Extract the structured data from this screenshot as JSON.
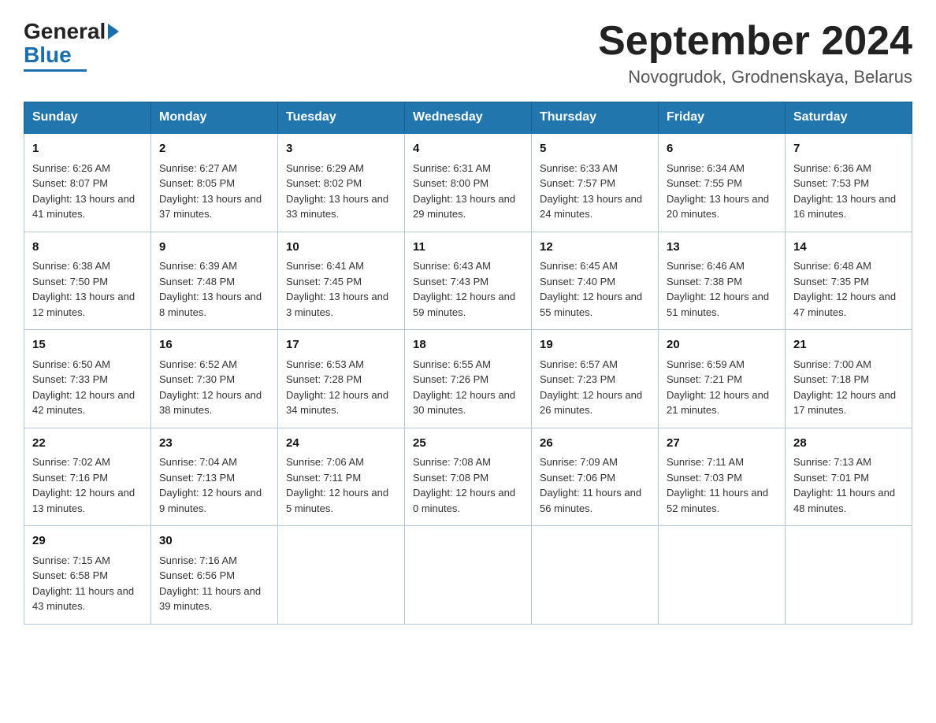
{
  "logo": {
    "general": "General",
    "blue": "Blue"
  },
  "title": "September 2024",
  "subtitle": "Novogrudok, Grodnenskaya, Belarus",
  "days_of_week": [
    "Sunday",
    "Monday",
    "Tuesday",
    "Wednesday",
    "Thursday",
    "Friday",
    "Saturday"
  ],
  "weeks": [
    [
      {
        "day": "1",
        "sunrise": "6:26 AM",
        "sunset": "8:07 PM",
        "daylight": "13 hours and 41 minutes."
      },
      {
        "day": "2",
        "sunrise": "6:27 AM",
        "sunset": "8:05 PM",
        "daylight": "13 hours and 37 minutes."
      },
      {
        "day": "3",
        "sunrise": "6:29 AM",
        "sunset": "8:02 PM",
        "daylight": "13 hours and 33 minutes."
      },
      {
        "day": "4",
        "sunrise": "6:31 AM",
        "sunset": "8:00 PM",
        "daylight": "13 hours and 29 minutes."
      },
      {
        "day": "5",
        "sunrise": "6:33 AM",
        "sunset": "7:57 PM",
        "daylight": "13 hours and 24 minutes."
      },
      {
        "day": "6",
        "sunrise": "6:34 AM",
        "sunset": "7:55 PM",
        "daylight": "13 hours and 20 minutes."
      },
      {
        "day": "7",
        "sunrise": "6:36 AM",
        "sunset": "7:53 PM",
        "daylight": "13 hours and 16 minutes."
      }
    ],
    [
      {
        "day": "8",
        "sunrise": "6:38 AM",
        "sunset": "7:50 PM",
        "daylight": "13 hours and 12 minutes."
      },
      {
        "day": "9",
        "sunrise": "6:39 AM",
        "sunset": "7:48 PM",
        "daylight": "13 hours and 8 minutes."
      },
      {
        "day": "10",
        "sunrise": "6:41 AM",
        "sunset": "7:45 PM",
        "daylight": "13 hours and 3 minutes."
      },
      {
        "day": "11",
        "sunrise": "6:43 AM",
        "sunset": "7:43 PM",
        "daylight": "12 hours and 59 minutes."
      },
      {
        "day": "12",
        "sunrise": "6:45 AM",
        "sunset": "7:40 PM",
        "daylight": "12 hours and 55 minutes."
      },
      {
        "day": "13",
        "sunrise": "6:46 AM",
        "sunset": "7:38 PM",
        "daylight": "12 hours and 51 minutes."
      },
      {
        "day": "14",
        "sunrise": "6:48 AM",
        "sunset": "7:35 PM",
        "daylight": "12 hours and 47 minutes."
      }
    ],
    [
      {
        "day": "15",
        "sunrise": "6:50 AM",
        "sunset": "7:33 PM",
        "daylight": "12 hours and 42 minutes."
      },
      {
        "day": "16",
        "sunrise": "6:52 AM",
        "sunset": "7:30 PM",
        "daylight": "12 hours and 38 minutes."
      },
      {
        "day": "17",
        "sunrise": "6:53 AM",
        "sunset": "7:28 PM",
        "daylight": "12 hours and 34 minutes."
      },
      {
        "day": "18",
        "sunrise": "6:55 AM",
        "sunset": "7:26 PM",
        "daylight": "12 hours and 30 minutes."
      },
      {
        "day": "19",
        "sunrise": "6:57 AM",
        "sunset": "7:23 PM",
        "daylight": "12 hours and 26 minutes."
      },
      {
        "day": "20",
        "sunrise": "6:59 AM",
        "sunset": "7:21 PM",
        "daylight": "12 hours and 21 minutes."
      },
      {
        "day": "21",
        "sunrise": "7:00 AM",
        "sunset": "7:18 PM",
        "daylight": "12 hours and 17 minutes."
      }
    ],
    [
      {
        "day": "22",
        "sunrise": "7:02 AM",
        "sunset": "7:16 PM",
        "daylight": "12 hours and 13 minutes."
      },
      {
        "day": "23",
        "sunrise": "7:04 AM",
        "sunset": "7:13 PM",
        "daylight": "12 hours and 9 minutes."
      },
      {
        "day": "24",
        "sunrise": "7:06 AM",
        "sunset": "7:11 PM",
        "daylight": "12 hours and 5 minutes."
      },
      {
        "day": "25",
        "sunrise": "7:08 AM",
        "sunset": "7:08 PM",
        "daylight": "12 hours and 0 minutes."
      },
      {
        "day": "26",
        "sunrise": "7:09 AM",
        "sunset": "7:06 PM",
        "daylight": "11 hours and 56 minutes."
      },
      {
        "day": "27",
        "sunrise": "7:11 AM",
        "sunset": "7:03 PM",
        "daylight": "11 hours and 52 minutes."
      },
      {
        "day": "28",
        "sunrise": "7:13 AM",
        "sunset": "7:01 PM",
        "daylight": "11 hours and 48 minutes."
      }
    ],
    [
      {
        "day": "29",
        "sunrise": "7:15 AM",
        "sunset": "6:58 PM",
        "daylight": "11 hours and 43 minutes."
      },
      {
        "day": "30",
        "sunrise": "7:16 AM",
        "sunset": "6:56 PM",
        "daylight": "11 hours and 39 minutes."
      },
      {
        "day": "",
        "sunrise": "",
        "sunset": "",
        "daylight": ""
      },
      {
        "day": "",
        "sunrise": "",
        "sunset": "",
        "daylight": ""
      },
      {
        "day": "",
        "sunrise": "",
        "sunset": "",
        "daylight": ""
      },
      {
        "day": "",
        "sunrise": "",
        "sunset": "",
        "daylight": ""
      },
      {
        "day": "",
        "sunrise": "",
        "sunset": "",
        "daylight": ""
      }
    ]
  ]
}
